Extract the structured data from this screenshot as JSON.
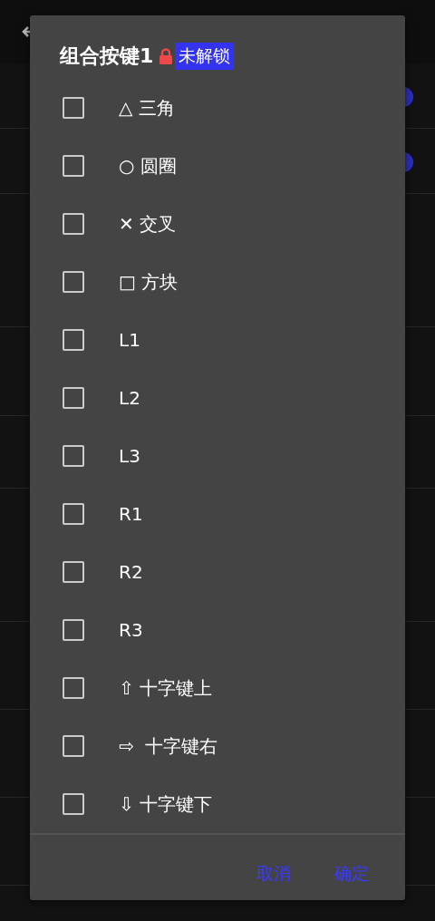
{
  "background": {
    "rows": [
      {
        "kind": "setting",
        "switch_on": true
      },
      {
        "kind": "setting",
        "switch_on": true
      },
      {
        "kind": "setting"
      },
      {
        "kind": "setting"
      },
      {
        "kind": "setting"
      },
      {
        "kind": "setting"
      },
      {
        "kind": "setting"
      },
      {
        "kind": "setting"
      },
      {
        "kind": "setting"
      }
    ]
  },
  "dialog": {
    "title": "组合按键1",
    "locked": true,
    "badge": "未解锁",
    "options": [
      {
        "label": "△ 三角",
        "checked": false
      },
      {
        "label": "○ 圆圈",
        "checked": false
      },
      {
        "label": "✕ 交叉",
        "checked": false
      },
      {
        "label": "□ 方块",
        "checked": false
      },
      {
        "label": "L1",
        "checked": false
      },
      {
        "label": "L2",
        "checked": false
      },
      {
        "label": "L3",
        "checked": false
      },
      {
        "label": "R1",
        "checked": false
      },
      {
        "label": "R2",
        "checked": false
      },
      {
        "label": "R3",
        "checked": false
      },
      {
        "label": "⇧ 十字键上",
        "checked": false
      },
      {
        "label": "⇨  十字键右",
        "checked": false
      },
      {
        "label": "⇩ 十字键下",
        "checked": false
      }
    ],
    "buttons": [
      "取消",
      "确定"
    ]
  }
}
